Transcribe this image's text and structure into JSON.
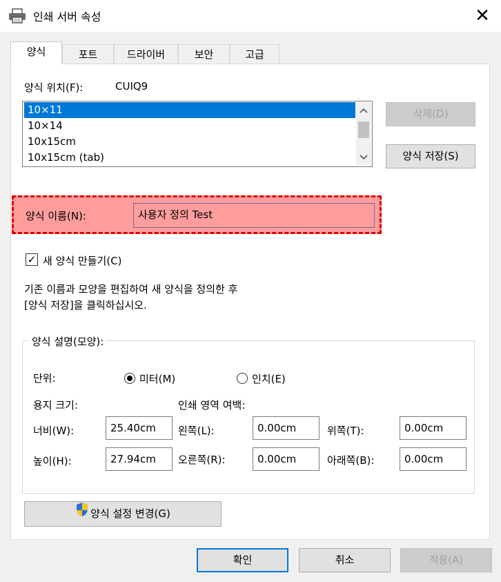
{
  "window": {
    "title": "인쇄 서버 속성",
    "close_symbol": "✕"
  },
  "tabs": [
    "양식",
    "포트",
    "드라이버",
    "보안",
    "고급"
  ],
  "form_location": {
    "label": "양식 위치(F):",
    "value": "CUIQ9"
  },
  "forms_list": {
    "items": [
      "10×11",
      "10×14",
      "10x15cm",
      "10x15cm (tab)"
    ],
    "selected_index": 0
  },
  "buttons": {
    "delete": "삭제(D)",
    "save_form": "양식 저장(S)",
    "change_settings": "양식 설정 변경(G)",
    "ok": "확인",
    "cancel": "취소",
    "apply": "적용(A)"
  },
  "form_name": {
    "label": "양식 이름(N):",
    "value": "사용자 정의 Test"
  },
  "new_form_checkbox": {
    "label": "새 양식 만들기(C)",
    "checked": true,
    "check_glyph": "✓"
  },
  "instructions": {
    "line1": "기존 이름과 모양을 편집하여 새 양식을 정의한 후",
    "line2": "[양식 저장]을 클릭하십시오."
  },
  "description_group": {
    "title": "양식 설명(모양):",
    "unit_label": "단위:",
    "unit_metric": "미터(M)",
    "unit_inch": "인치(E)",
    "selected_unit": "metric",
    "paper_size_label": "용지 크기:",
    "margins_label": "인쇄 영역 여백:",
    "width_label": "너비(W):",
    "width_value": "25.40cm",
    "height_label": "높이(H):",
    "height_value": "27.94cm",
    "left_label": "왼쪽(L):",
    "left_value": "0.00cm",
    "right_label": "오른쪽(R):",
    "right_value": "0.00cm",
    "top_label": "위쪽(T):",
    "top_value": "0.00cm",
    "bottom_label": "아래쪽(B):",
    "bottom_value": "0.00cm"
  },
  "icons": [
    "printer-icon",
    "close-icon",
    "shield-icon",
    "scroll-up-icon",
    "scroll-down-icon"
  ],
  "colors": {
    "selection": "#0078d7",
    "highlight_fill": "#ff9d9d",
    "highlight_border": "#e00000"
  }
}
